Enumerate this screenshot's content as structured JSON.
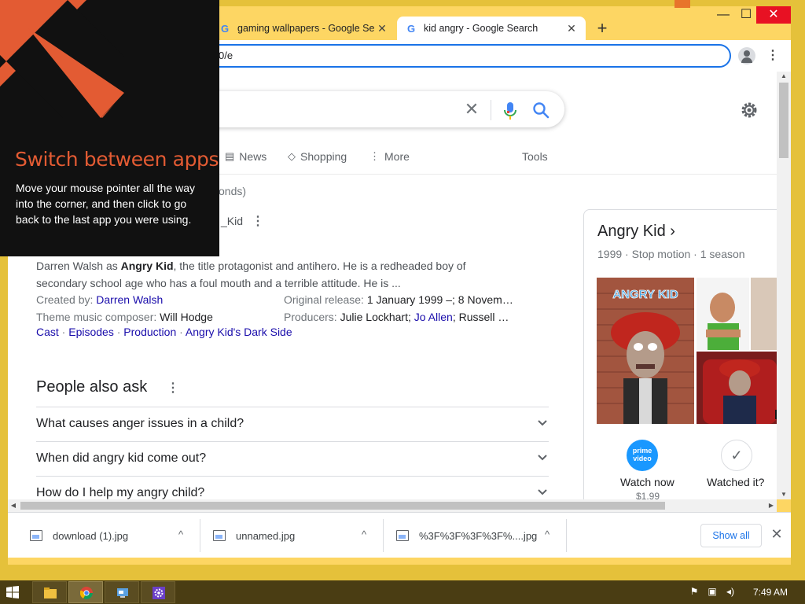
{
  "browser": {
    "tabs": [
      {
        "title": "gaming wallpapers - Google Sea",
        "active": false
      },
      {
        "title": "kid angry - Google Search",
        "active": true
      }
    ],
    "new_tab": "+",
    "omnibox_text": "0/e",
    "window_controls": {
      "minimize": "—",
      "maximize": "☐",
      "close": "✕"
    }
  },
  "search": {
    "clear": "✕"
  },
  "nav_tabs": [
    {
      "icon": "news-icon",
      "label": "News"
    },
    {
      "icon": "shopping-icon",
      "label": "Shopping"
    },
    {
      "icon": "more-icon",
      "label": "More"
    },
    {
      "icon": "",
      "label": "Tools"
    }
  ],
  "result_stats": "onds)",
  "entity_fragment": "_Kid",
  "snippet": {
    "prefix": "Darren Walsh as ",
    "bold": "Angry Kid",
    "suffix": ", the title protagonist and antihero. He is a redheaded boy of secondary school age who has a foul mouth and a terrible attitude. He is ..."
  },
  "facts": [
    {
      "key": "Created by: ",
      "value": "Darren Walsh",
      "link": true
    },
    {
      "key": "Original release: ",
      "value": "1 January 1999 –; 8 Novem…",
      "link": false
    },
    {
      "key": "Theme music composer: ",
      "value": "Will Hodge",
      "link": false
    },
    {
      "key": "Producers: ",
      "value_parts": [
        "Julie Lockhart; ",
        "Jo Allen",
        "; Russell …"
      ]
    }
  ],
  "links": [
    "Cast",
    "Episodes",
    "Production",
    "Angry Kid's Dark Side"
  ],
  "people_also_ask": {
    "title": "People also ask",
    "questions": [
      "What causes anger issues in a child?",
      "When did angry kid come out?",
      "How do I help my angry child?"
    ]
  },
  "knowledge_panel": {
    "title": "Angry Kid",
    "chevron": "›",
    "subtitle": "1999 · Stop motion · 1 season",
    "image_caption": "ANGRY KID",
    "watch": [
      {
        "label": "Watch now",
        "price": "$1.99",
        "provider_line1": "prime",
        "provider_line2": "video"
      },
      {
        "label": "Watched it?",
        "mark": "✓"
      }
    ]
  },
  "downloads": {
    "items": [
      "download (1).jpg",
      "unnamed.jpg",
      "%3F%3F%3F%3F%....jpg"
    ],
    "caret": "^",
    "show_all": "Show all",
    "close": "✕"
  },
  "overlay": {
    "title": "Switch between apps",
    "body": "Move your mouse pointer all the way into the corner, and then click to go back to the last app you were using."
  },
  "taskbar": {
    "apps": [
      "file-explorer-icon",
      "chrome-icon",
      "control-panel-icon",
      "settings-app-icon"
    ],
    "tray": [
      "flag-icon",
      "network-icon",
      "volume-icon"
    ],
    "clock": "7:49 AM"
  },
  "colors": {
    "frame": "#e5c13a",
    "link": "#1a0dab",
    "accent": "#1a73e8",
    "overlay_title": "#e35b33",
    "taskbar": "#4a3d13"
  }
}
